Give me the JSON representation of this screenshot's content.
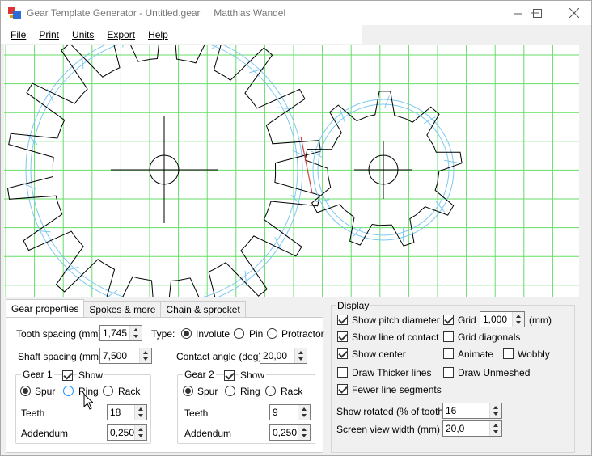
{
  "window": {
    "title": "Gear Template Generator - Untitled.gear     Matthias Wandel"
  },
  "menu": [
    "File",
    "Print",
    "Units",
    "Export",
    "Help"
  ],
  "tabs": [
    "Gear properties",
    "Spokes & more",
    "Chain & sprocket"
  ],
  "gear_props": {
    "tooth_spacing_label": "Tooth spacing (mm)",
    "tooth_spacing": "1,745",
    "shaft_spacing_label": "Shaft spacing (mm)",
    "shaft_spacing": "7,500",
    "type_label": "Type:",
    "type_options": [
      "Involute",
      "Pin",
      "Protractor"
    ],
    "type_selected": "Involute",
    "contact_angle_label": "Contact angle (deg)",
    "contact_angle": "20,00"
  },
  "gear1": {
    "title": "Gear 1",
    "show_label": "Show",
    "show": true,
    "options": [
      "Spur",
      "Ring",
      "Rack"
    ],
    "selected": "Spur",
    "teeth_label": "Teeth",
    "teeth": "18",
    "addendum_label": "Addendum",
    "addendum": "0,250"
  },
  "gear2": {
    "title": "Gear 2",
    "show_label": "Show",
    "show": true,
    "options": [
      "Spur",
      "Ring",
      "Rack"
    ],
    "selected": "Spur",
    "teeth_label": "Teeth",
    "teeth": "9",
    "addendum_label": "Addendum",
    "addendum": "0,250"
  },
  "display": {
    "title": "Display",
    "show_pitch_diameter": {
      "label": "Show pitch diameter",
      "checked": true
    },
    "show_line_of_contact": {
      "label": "Show line of contact",
      "checked": true
    },
    "show_center": {
      "label": "Show center",
      "checked": true
    },
    "draw_thicker_lines": {
      "label": "Draw Thicker lines",
      "checked": false
    },
    "fewer_line_segments": {
      "label": "Fewer line segments",
      "checked": true
    },
    "grid": {
      "label": "Grid",
      "checked": true,
      "value": "1,000",
      "unit": "(mm)"
    },
    "grid_diagonals": {
      "label": "Grid diagonals",
      "checked": false
    },
    "animate": {
      "label": "Animate",
      "checked": false
    },
    "wobbly": {
      "label": "Wobbly",
      "checked": false
    },
    "draw_unmeshed": {
      "label": "Draw Unmeshed",
      "checked": false
    },
    "show_rotated_label": "Show rotated (% of tooth)",
    "show_rotated": "16",
    "screen_view_width_label": "Screen view width (mm)",
    "screen_view_width": "20,0"
  },
  "colors": {
    "grid": "#66dd66",
    "pitch": "#7ec8f0",
    "gear": "#000000",
    "contact": "#d04040"
  },
  "icons": {
    "app": "gear-app-icon",
    "minimize": "minimize-icon",
    "maximize": "maximize-icon",
    "close": "close-icon"
  }
}
